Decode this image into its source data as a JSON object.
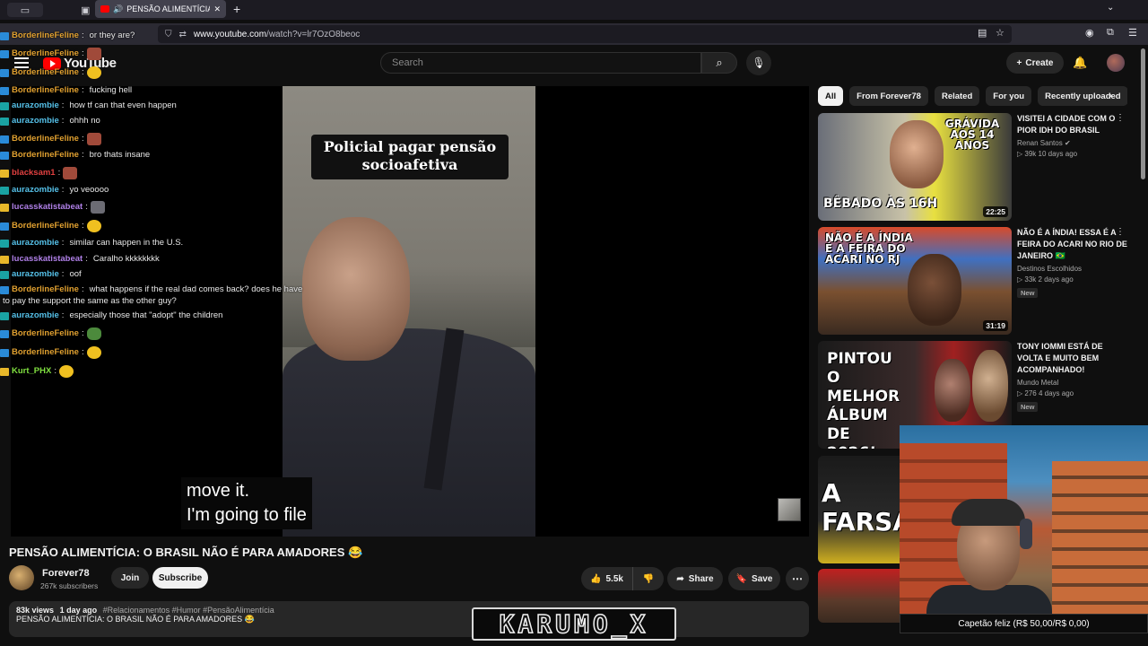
{
  "browser": {
    "tab_title": "PENSÃO ALIMENTÍCIA: O BRASIL",
    "url_host": "www.youtube.com",
    "url_path": "/watch?v=lr7OzO8beoc"
  },
  "header": {
    "logo_text": "YouTube",
    "search_placeholder": "Search",
    "create_label": "Create"
  },
  "player": {
    "overlay_text": "Policial pagar pensão socioafetiva",
    "caption_line1": "move it.",
    "caption_line2": "I'm going to file"
  },
  "chat": [
    {
      "user": "BorderlineFeline",
      "color": "#e0a030",
      "text": "or they are?",
      "emote": ""
    },
    {
      "user": "BorderlineFeline",
      "color": "#e0a030",
      "text": "",
      "emote": "red"
    },
    {
      "user": "BorderlineFeline",
      "color": "#e0a030",
      "text": "",
      "emote": "yellow"
    },
    {
      "user": "BorderlineFeline",
      "color": "#e0a030",
      "text": "fucking hell",
      "emote": ""
    },
    {
      "user": "aurazombie",
      "color": "#55c0e8",
      "text": "how tf can that even happen",
      "emote": ""
    },
    {
      "user": "aurazombie",
      "color": "#55c0e8",
      "text": "ohhh no",
      "emote": ""
    },
    {
      "user": "BorderlineFeline",
      "color": "#e0a030",
      "text": "",
      "emote": "red"
    },
    {
      "user": "BorderlineFeline",
      "color": "#e0a030",
      "text": "bro thats insane",
      "emote": ""
    },
    {
      "user": "blacksam1",
      "color": "#e04040",
      "text": "",
      "emote": "red"
    },
    {
      "user": "aurazombie",
      "color": "#55c0e8",
      "text": "yo veoooo",
      "emote": ""
    },
    {
      "user": "lucasskatistabeat",
      "color": "#b080e8",
      "text": "",
      "emote": "gray"
    },
    {
      "user": "BorderlineFeline",
      "color": "#e0a030",
      "text": "",
      "emote": "yellow"
    },
    {
      "user": "aurazombie",
      "color": "#55c0e8",
      "text": "similar can happen in the U.S.",
      "emote": ""
    },
    {
      "user": "lucasskatistabeat",
      "color": "#b080e8",
      "text": "Caralho kkkkkkkk",
      "emote": ""
    },
    {
      "user": "aurazombie",
      "color": "#55c0e8",
      "text": "oof",
      "emote": ""
    },
    {
      "user": "BorderlineFeline",
      "color": "#e0a030",
      "text": "what happens if the real dad comes back? does he have",
      "emote": ""
    },
    {
      "user": "",
      "color": "#e8e8e8",
      "text": "to pay the support the same as the other guy?",
      "emote": ""
    },
    {
      "user": "aurazombie",
      "color": "#55c0e8",
      "text": "especially those that \"adopt\" the children",
      "emote": ""
    },
    {
      "user": "BorderlineFeline",
      "color": "#e0a030",
      "text": "",
      "emote": "frog"
    },
    {
      "user": "BorderlineFeline",
      "color": "#e0a030",
      "text": "",
      "emote": "yellow"
    },
    {
      "user": "Kurt_PHX",
      "color": "#80e040",
      "text": "",
      "emote": "yellow"
    }
  ],
  "video": {
    "title": "PENSÃO ALIMENTÍCIA: O BRASIL NÃO É PARA AMADORES 😂",
    "channel": "Forever78",
    "subscribers": "267k subscribers",
    "join_label": "Join",
    "subscribe_label": "Subscribe",
    "likes": "5.5k",
    "share_label": "Share",
    "save_label": "Save",
    "views": "83k views",
    "age": "1 day ago",
    "tags": "#Relacionamentos #Humor #PensãoAlimentícia",
    "description_line": "PENSÃO ALIMENTÍCIA: O BRASIL NÃO É PARA AMADORES 😂"
  },
  "chips": [
    "All",
    "From Forever78",
    "Related",
    "For you",
    "Recently uploaded"
  ],
  "recommendations": [
    {
      "title": "VISITEI A CIDADE COM O PIOR IDH DO BRASIL",
      "channel": "Renan Santos",
      "verified": true,
      "views": "39k",
      "age": "10 days ago",
      "duration": "22:25",
      "is_new": false,
      "thumb_text_top": "GRÁVIDA AOS 14 ANOS",
      "thumb_text_bottom": "BÊBADO ÀS 16H"
    },
    {
      "title": "NÃO É A ÍNDIA! ESSA É A FEIRA DO ACARI NO RIO DE JANEIRO 🇧🇷",
      "channel": "Destinos Escolhidos",
      "verified": false,
      "views": "33k",
      "age": "2 days ago",
      "duration": "31:19",
      "is_new": true,
      "new_label": "New",
      "thumb_text_top": "NÃO É A ÍNDIA É A FEIRA DO ACARI NO RJ"
    },
    {
      "title": "TONY IOMMI ESTÁ DE VOLTA E MUITO BEM ACOMPANHADO!",
      "channel": "Mundo Metal",
      "verified": false,
      "views": "276",
      "age": "4 days ago",
      "duration": "",
      "is_new": true,
      "new_label": "New",
      "thumb_text_top": "PINTOU O MELHOR ÁLBUM DE 2026!"
    },
    {
      "title": "",
      "channel": "",
      "views": "",
      "age": "",
      "thumb_text_top": "A FARSA"
    }
  ],
  "overlay": {
    "goal_text": "Capetão feliz (R$ 50,00/R$ 0,00)",
    "streamer_name": "KARUMO_X"
  },
  "colors": {
    "background": "#0f0f0f",
    "youtube_red": "#ff0000",
    "chip_active": "#f1f1f1"
  }
}
